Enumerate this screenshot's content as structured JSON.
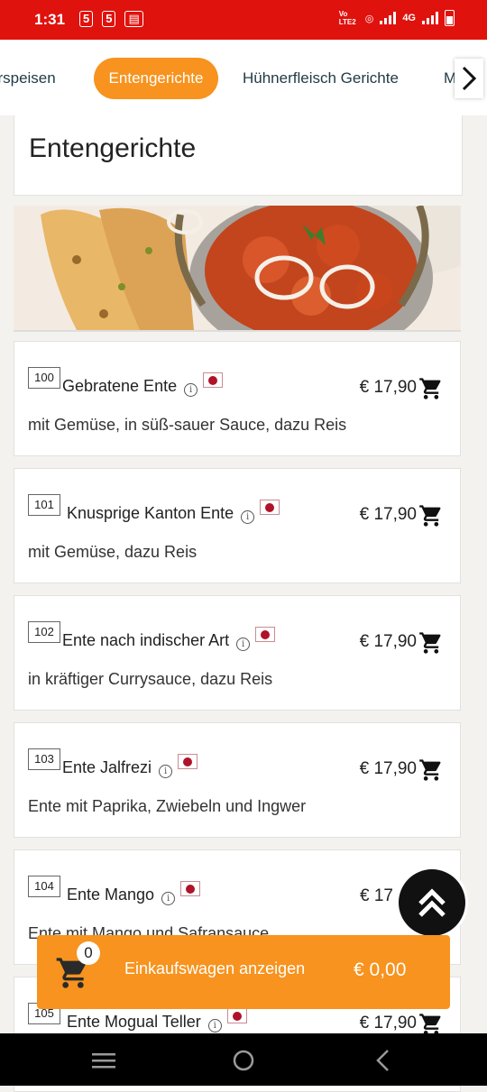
{
  "status_bar": {
    "time": "1:31",
    "notif_icons": [
      "5",
      "5"
    ],
    "network": "Vo LTE2",
    "signal_label": "4G"
  },
  "tabs": [
    "orspeisen",
    "Entengerichte",
    "Hühnerfleisch Gerichte",
    "Me"
  ],
  "active_tab": "Entengerichte",
  "section": {
    "title": "Entengerichte"
  },
  "dishes": [
    {
      "number": "100",
      "name": "Gebratene Ente",
      "description": "mit Gemüse, in süß-sauer Sauce, dazu Reis",
      "price": "€ 17,90"
    },
    {
      "number": "101",
      "name": "Knusprige Kanton Ente",
      "description": "mit Gemüse, dazu Reis",
      "price": "€ 17,90"
    },
    {
      "number": "102",
      "name": "Ente nach indischer Art",
      "description": "in kräftiger Currysauce, dazu Reis",
      "price": "€ 17,90"
    },
    {
      "number": "103",
      "name": "Ente Jalfrezi",
      "description": "Ente mit Paprika, Zwiebeln und Ingwer",
      "price": "€ 17,90"
    },
    {
      "number": "104",
      "name": "Ente Mango",
      "description": "Ente mit Mango und Safransauce",
      "price": "€ 17"
    },
    {
      "number": "105",
      "name": "Ente Mogual Teller",
      "description": "",
      "price": "€ 17,90"
    }
  ],
  "cart": {
    "count": "0",
    "label": "Einkaufswagen anzeigen",
    "total": "€ 0,00"
  },
  "colors": {
    "accent": "#f7931e",
    "status_bar": "#e0120d"
  },
  "icons": [
    "next-arrow-icon",
    "info-icon",
    "flag-icon",
    "cart-add-icon",
    "scroll-top-icon",
    "cart-icon",
    "menu-icon",
    "home-icon",
    "back-icon"
  ]
}
